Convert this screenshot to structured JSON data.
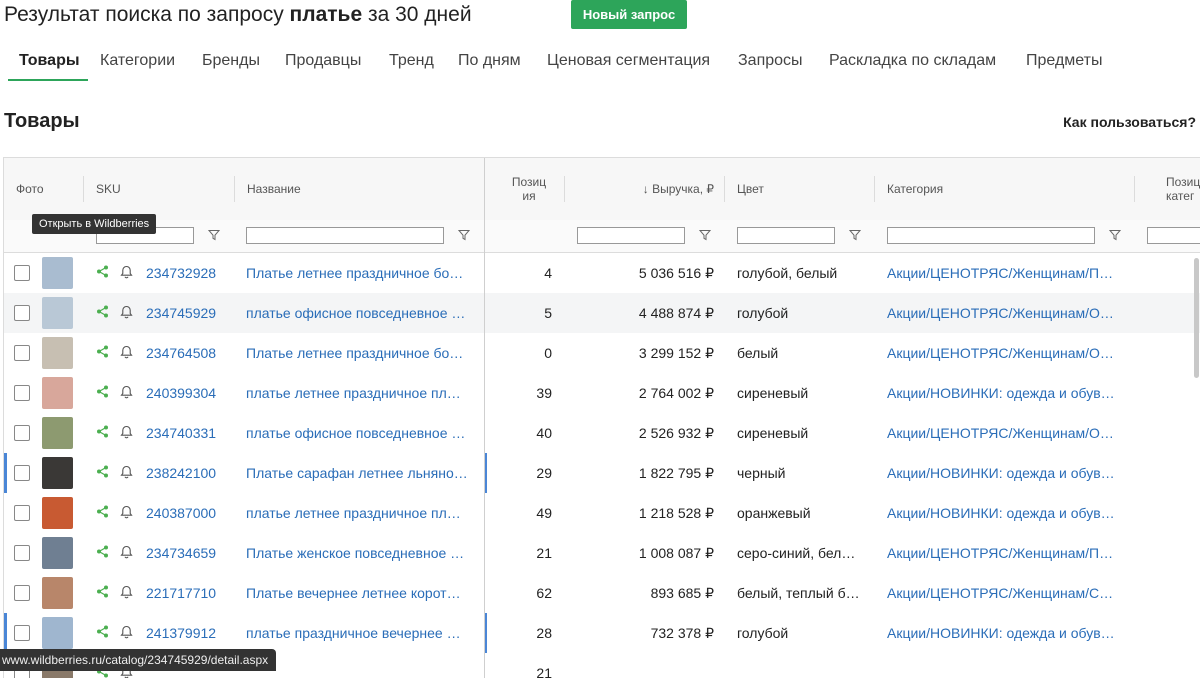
{
  "header": {
    "title_prefix": "Результат поиска по запросу ",
    "title_query": "платье",
    "title_suffix": " за 30 дней",
    "new_query_label": "Новый запрос"
  },
  "tabs": [
    {
      "label": "Товары"
    },
    {
      "label": "Категории"
    },
    {
      "label": "Бренды"
    },
    {
      "label": "Продавцы"
    },
    {
      "label": "Тренд"
    },
    {
      "label": "По дням"
    },
    {
      "label": "Ценовая сегментация"
    },
    {
      "label": "Запросы"
    },
    {
      "label": "Раскладка по складам"
    },
    {
      "label": "Предметы"
    }
  ],
  "section": {
    "title": "Товары",
    "help_label": "Как пользоваться?"
  },
  "columns": {
    "photo": "Фото",
    "sku": "SKU",
    "name": "Название",
    "position": "Позиц\nия",
    "revenue": "↓ Выручка, ₽",
    "color": "Цвет",
    "category": "Категория",
    "cat_position": "Позиц\nкатег"
  },
  "tooltip": "Открыть в Wildberries",
  "statusbar_url": "www.wildberries.ru/catalog/234745929/detail.aspx",
  "rows": [
    {
      "sku": "234732928",
      "name": "Платье летнее праздничное бо…",
      "position": "4",
      "revenue": "5 036 516 ₽",
      "color": "голубой, белый",
      "category": "Акции/ЦЕНОТРЯС/Женщинам/П…",
      "thumb_color": "#a9bcd0"
    },
    {
      "sku": "234745929",
      "name": "платье офисное повседневное …",
      "position": "5",
      "revenue": "4 488 874 ₽",
      "color": "голубой",
      "category": "Акции/ЦЕНОТРЯС/Женщинам/О…",
      "thumb_color": "#b9c8d6"
    },
    {
      "sku": "234764508",
      "name": "Платье летнее праздничное бо…",
      "position": "0",
      "revenue": "3 299 152 ₽",
      "color": "белый",
      "category": "Акции/ЦЕНОТРЯС/Женщинам/О…",
      "thumb_color": "#c7bfb2"
    },
    {
      "sku": "240399304",
      "name": "платье летнее праздничное пл…",
      "position": "39",
      "revenue": "2 764 002 ₽",
      "color": "сиреневый",
      "category": "Акции/НОВИНКИ: одежда и обув…",
      "thumb_color": "#d8a79b"
    },
    {
      "sku": "234740331",
      "name": "платье офисное повседневное …",
      "position": "40",
      "revenue": "2 526 932 ₽",
      "color": "сиреневый",
      "category": "Акции/ЦЕНОТРЯС/Женщинам/О…",
      "thumb_color": "#8d9a70"
    },
    {
      "sku": "238242100",
      "name": "Платье сарафан летнее льняно…",
      "position": "29",
      "revenue": "1 822 795 ₽",
      "color": "черный",
      "category": "Акции/НОВИНКИ: одежда и обув…",
      "thumb_color": "#3a3836"
    },
    {
      "sku": "240387000",
      "name": "платье летнее праздничное пл…",
      "position": "49",
      "revenue": "1 218 528 ₽",
      "color": "оранжевый",
      "category": "Акции/НОВИНКИ: одежда и обув…",
      "thumb_color": "#c85a32"
    },
    {
      "sku": "234734659",
      "name": "Платье женское повседневное …",
      "position": "21",
      "revenue": "1 008 087 ₽",
      "color": "серо-синий, бел…",
      "category": "Акции/ЦЕНОТРЯС/Женщинам/П…",
      "thumb_color": "#6f7f92"
    },
    {
      "sku": "221717710",
      "name": "Платье вечернее летнее корот…",
      "position": "62",
      "revenue": "893 685 ₽",
      "color": "белый, теплый б…",
      "category": "Акции/ЦЕНОТРЯС/Женщинам/Св…",
      "thumb_color": "#b8866a"
    },
    {
      "sku": "241379912",
      "name": "платье праздничное вечернее …",
      "position": "28",
      "revenue": "732 378 ₽",
      "color": "голубой",
      "category": "Акции/НОВИНКИ: одежда и обув…",
      "thumb_color": "#9fb6cf"
    },
    {
      "sku": "",
      "name": "",
      "position": "21",
      "revenue": "",
      "color": "",
      "category": "",
      "thumb_color": "#8a7a6a"
    }
  ]
}
